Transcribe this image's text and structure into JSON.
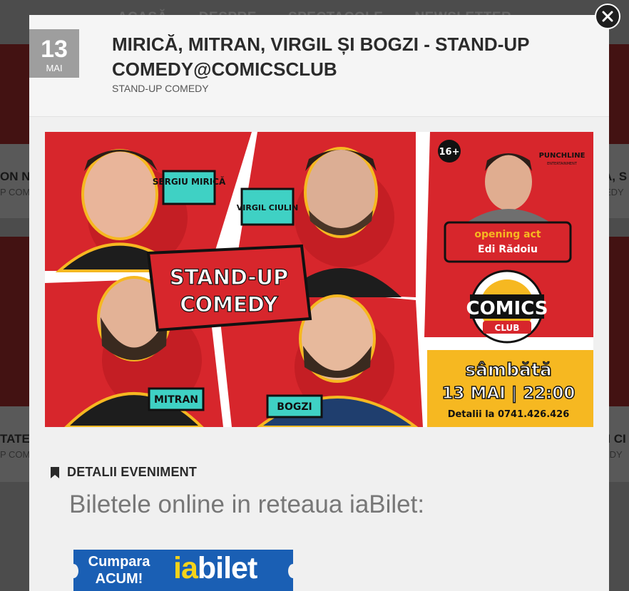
{
  "background": {
    "nav": [
      "ACASĂ",
      "DESPRE",
      "SPECTACOLE",
      "NEWSLETTER"
    ],
    "cards": [
      {
        "title_left": "ON NE",
        "sub_left": "P COM"
      },
      {
        "title_right": "A, S",
        "sub_right": "EDY"
      },
      {
        "title_left2": "TATE",
        "sub_left2": "P COM"
      },
      {
        "title_right2": "EI CI",
        "sub_right2": "EDY"
      }
    ]
  },
  "modal": {
    "date": {
      "day": "13",
      "month": "MAI"
    },
    "title": "MIRICĂ, MITRAN, VIRGIL ȘI BOGZI - STAND-UP COMEDY@COMICSCLUB",
    "category": "STAND-UP COMEDY",
    "banner": {
      "names": [
        "SERGIU MIRICĂ",
        "VIRGIL CIULIN",
        "MITRAN",
        "BOGZI"
      ],
      "headline": [
        "STAND-UP",
        "COMEDY"
      ],
      "age": "16+",
      "producer": "PUNCHLINE",
      "producer_sub": "ENTERTAINMENT",
      "opening_label": "opening act",
      "opening_name": "Edi Rădoiu",
      "venue_top": "COMICS",
      "venue_bottom": "CLUB",
      "day": "sâmbătă",
      "datetime": "13 MAI | 22:00",
      "contact": "Detalii la 0741.426.426"
    },
    "details_heading": "DETALII EVENIMENT",
    "tickets_text": "Biletele online in reteaua iaBilet:",
    "buy_button": {
      "line1": "Cumpara",
      "line2": "ACUM!",
      "brand_ia": "ia",
      "brand_rest": "bilet"
    }
  },
  "colors": {
    "accent_red": "#d7262c",
    "yellow": "#f6b821",
    "teal": "#3fd1c4",
    "iabilet_blue": "#1a5fb4"
  },
  "icons": {
    "close": "close-icon",
    "details": "bookmark-icon"
  }
}
